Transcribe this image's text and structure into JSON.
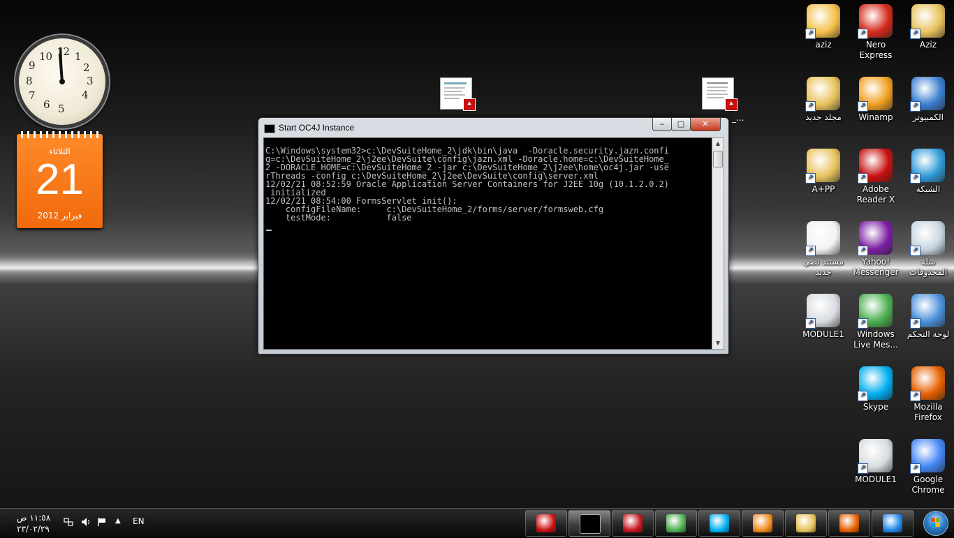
{
  "window": {
    "title": "Start OC4J Instance",
    "min_label": "‒",
    "max_label": "□",
    "close_label": "✕",
    "console_text": "C:\\Windows\\system32>c:\\DevSuiteHome_2\\jdk\\bin\\java  -Doracle.security.jazn.confi\ng=c:\\DevSuiteHome_2\\j2ee\\DevSuite\\config\\jazn.xml -Doracle.home=c:\\DevSuiteHome_\n2 -DORACLE_HOME=c:\\DevSuiteHome_2 -jar c:\\DevSuiteHome_2\\j2ee\\home\\oc4j.jar -use\nrThreads -config c:\\DevSuiteHome_2\\j2ee\\DevSuite\\config\\server.xml\n12/02/21 08:52:59 Oracle Application Server Containers for J2EE 10g (10.1.2.0.2)\n initialized\n12/02/21 08:54:00 FormsServlet init():\n    configFileName:     c:\\DevSuiteHome_2/forms/server/formsweb.cfg\n    testMode:           false"
  },
  "desktop_icons": [
    {
      "label": "aziz",
      "icon": "mail-icon",
      "color": "#f5c04a"
    },
    {
      "label": "Nero Express",
      "icon": "nero-icon",
      "color": "#d42a1c"
    },
    {
      "label": "Aziz",
      "icon": "user-folder-icon",
      "color": "#e8c25c"
    },
    {
      "label": "مجلد جديد",
      "icon": "folder-icon",
      "color": "#e8c25c"
    },
    {
      "label": "Winamp",
      "icon": "winamp-icon",
      "color": "#f0a020"
    },
    {
      "label": "الكمبيوتر",
      "icon": "computer-icon",
      "color": "#3a7fd0"
    },
    {
      "label": "A+PP",
      "icon": "folder-icon",
      "color": "#e8c25c"
    },
    {
      "label": "Adobe Reader X",
      "icon": "adobe-reader-icon",
      "color": "#c81010"
    },
    {
      "label": "الشبكة",
      "icon": "network-icon",
      "color": "#2f9ad8"
    },
    {
      "label": "مستند نصي جديد",
      "icon": "text-document-icon",
      "color": "#f2f2f2"
    },
    {
      "label": "Yahoo! Messenger",
      "icon": "yahoo-messenger-icon",
      "color": "#7b1fa2"
    },
    {
      "label": "سلة المحذوفات",
      "icon": "recycle-bin-icon",
      "color": "#c9d6e0"
    },
    {
      "label": "MODULE1",
      "icon": "forms-module-icon",
      "color": "#d8dce0"
    },
    {
      "label": "Windows Live Mes...",
      "icon": "live-messenger-icon",
      "color": "#4caf50"
    },
    {
      "label": "لوحة التحكم",
      "icon": "control-panel-icon",
      "color": "#4a90d9"
    },
    {
      "label": "Skype",
      "icon": "skype-icon",
      "color": "#00aff0"
    },
    {
      "label": "Mozilla Firefox",
      "icon": "firefox-icon",
      "color": "#e66000"
    },
    {
      "label": "MODULE1",
      "icon": "forms-module-icon",
      "color": "#d8dce0"
    },
    {
      "label": "Google Chrome",
      "icon": "chrome-icon",
      "color": "#4285f4"
    }
  ],
  "desktop_thumb_right_caption": "_...",
  "clock": {
    "numbers": [
      "12",
      "1",
      "2",
      "3",
      "4",
      "5",
      "6",
      "7",
      "8",
      "9",
      "10",
      "11"
    ]
  },
  "calendar": {
    "day": "الثلاثاء",
    "date": "21",
    "month": "فبراير 2012"
  },
  "taskbar": {
    "buttons": [
      {
        "icon": "adobe-reader-icon",
        "color": "#c81010"
      },
      {
        "icon": "cmd-icon",
        "color": "#000000"
      },
      {
        "icon": "oracle-forms-icon",
        "color": "#c8161e"
      },
      {
        "icon": "live-messenger-icon",
        "color": "#4caf50"
      },
      {
        "icon": "skype-icon",
        "color": "#00aff0"
      },
      {
        "icon": "media-player-icon",
        "color": "#f08a1c"
      },
      {
        "icon": "explorer-icon",
        "color": "#e8c25c"
      },
      {
        "icon": "firefox-icon",
        "color": "#e66000"
      },
      {
        "icon": "internet-explorer-icon",
        "color": "#1e88e5"
      }
    ],
    "language": "EN",
    "time": "١١:٥٨ ص",
    "date": "٢٣/٠٢/٢٩"
  }
}
